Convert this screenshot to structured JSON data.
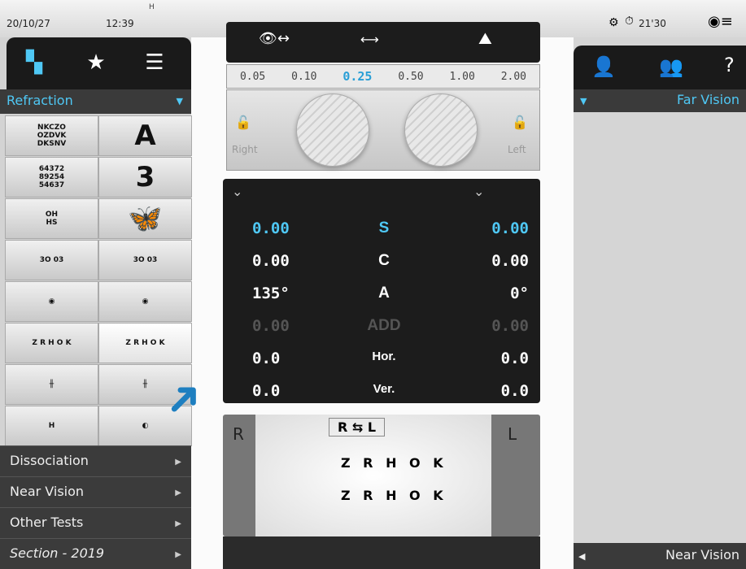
{
  "status": {
    "date": "20/10/27",
    "time": "12:39",
    "h_marker": "H",
    "timer": "21'30"
  },
  "left": {
    "selector": "Refraction",
    "menu": [
      {
        "label": "Dissociation"
      },
      {
        "label": "Near Vision"
      },
      {
        "label": "Other Tests"
      },
      {
        "label": "Section - 2019"
      }
    ],
    "grid": [
      {
        "l": "NKCZO\nOZDVK\nDKSNV",
        "r": "A"
      },
      {
        "l": "64372\n89254\n54637",
        "r": "3"
      },
      {
        "l": "OH\nHS",
        "r": "🦋"
      },
      {
        "l": "3O 03",
        "r": "3O 03"
      },
      {
        "l": "◉",
        "r": "◉"
      },
      {
        "l": "Z R H O K",
        "r": "Z R H O K"
      },
      {
        "l": "╫",
        "r": "╫"
      },
      {
        "l": "H",
        "r": "◐"
      }
    ]
  },
  "center": {
    "scale": [
      "0.05",
      "0.10",
      "0.25",
      "0.50",
      "1.00",
      "2.00"
    ],
    "selected_scale": "0.25",
    "right_label": "Right",
    "left_label": "Left",
    "rows": [
      {
        "left": "0.00",
        "mid": "S",
        "right": "0.00"
      },
      {
        "left": "0.00",
        "mid": "C",
        "right": "0.00"
      },
      {
        "left": "135°",
        "mid": "A",
        "right": "0°"
      },
      {
        "left": "0.00",
        "mid": "ADD",
        "right": "0.00"
      },
      {
        "left": "0.0",
        "mid": "Hor.",
        "right": "0.0"
      },
      {
        "left": "0.0",
        "mid": "Ver.",
        "right": "0.0"
      }
    ],
    "test": {
      "r": "R",
      "l": "L",
      "swap": "R ⇆ L",
      "line1": "Z R H O K",
      "line2": "Z R H O K"
    }
  },
  "right": {
    "title": "Far Vision",
    "bottom": "Near Vision",
    "help": "?"
  },
  "colors": {
    "accent": "#2a9fd6",
    "highlight": "#4fc8f5"
  }
}
